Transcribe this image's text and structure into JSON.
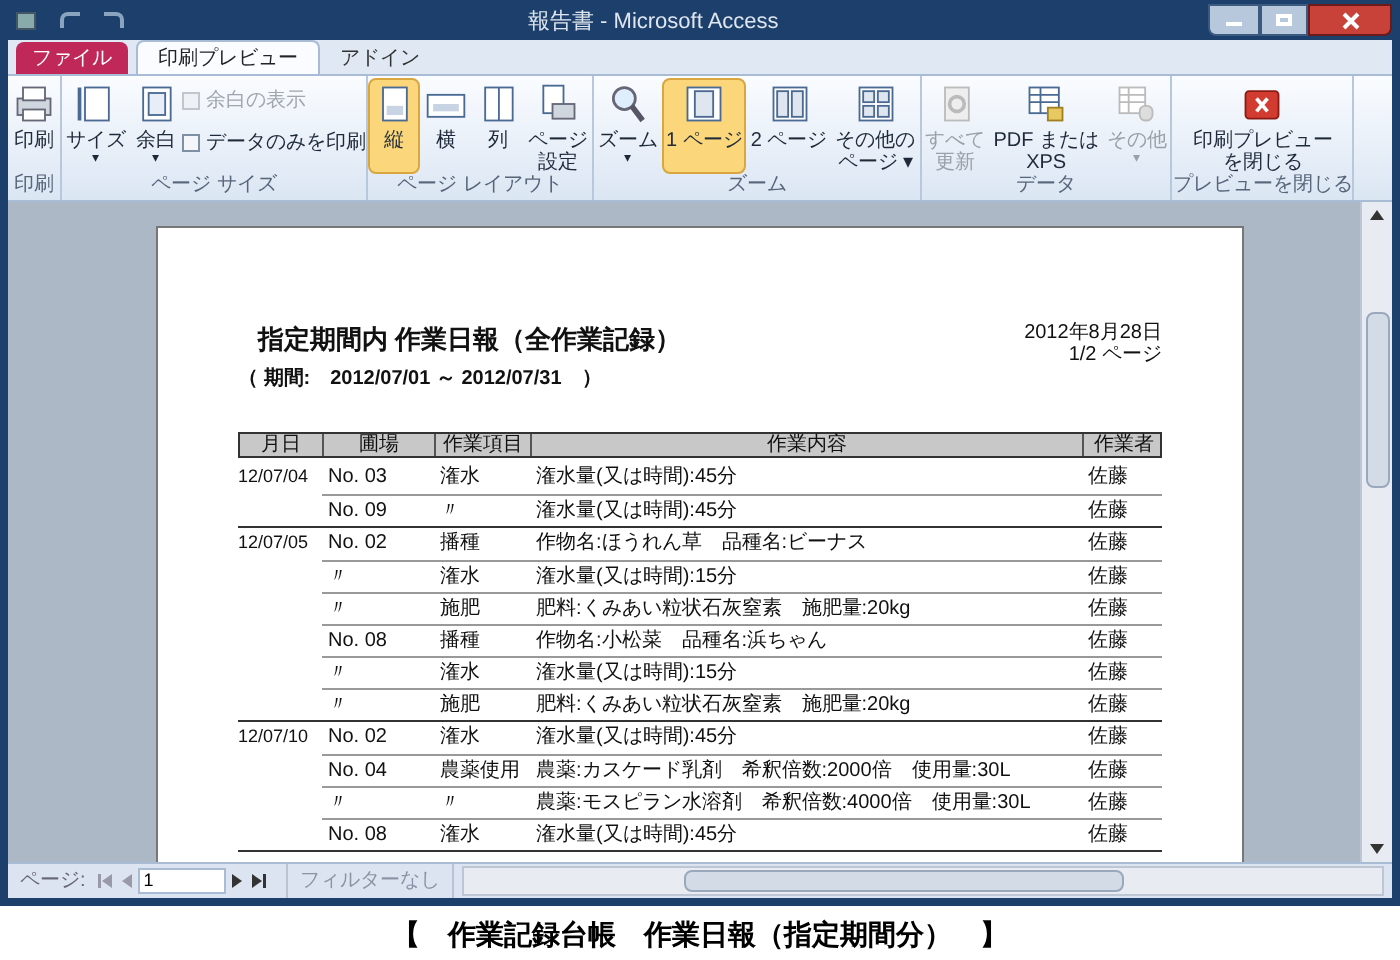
{
  "window": {
    "title": "報告書 - Microsoft Access"
  },
  "tabs": [
    {
      "label": "ファイル",
      "kind": "file",
      "selected": false
    },
    {
      "label": "印刷プレビュー",
      "kind": "tab",
      "selected": true
    },
    {
      "label": "アドイン",
      "kind": "tab",
      "selected": false
    }
  ],
  "ribbon": [
    {
      "label": "印刷",
      "items": [
        {
          "kind": "large",
          "lines": [
            "印刷"
          ],
          "disabled": false,
          "selected": false
        }
      ]
    },
    {
      "label": "ページ サイズ",
      "items": [
        {
          "kind": "large",
          "lines": [
            "サイズ"
          ],
          "arrow": "▾",
          "disabled": false,
          "selected": false
        },
        {
          "kind": "large",
          "lines": [
            "余白"
          ],
          "arrow": "▾",
          "disabled": false,
          "selected": false
        },
        {
          "kind": "checks",
          "checks": [
            {
              "label": "余白の表示",
              "checked": false,
              "disabled": true
            },
            {
              "label": "データのみを印刷",
              "checked": false,
              "disabled": false
            }
          ]
        }
      ]
    },
    {
      "label": "ページ レイアウト",
      "items": [
        {
          "kind": "large",
          "lines": [
            "縦"
          ],
          "disabled": false,
          "selected": true
        },
        {
          "kind": "large",
          "lines": [
            "横"
          ],
          "disabled": false,
          "selected": false
        },
        {
          "kind": "large",
          "lines": [
            "列"
          ],
          "disabled": false,
          "selected": false
        },
        {
          "kind": "large",
          "lines": [
            "ページ",
            "設定"
          ],
          "disabled": false,
          "selected": false
        }
      ]
    },
    {
      "label": "ズーム",
      "items": [
        {
          "kind": "large",
          "lines": [
            "ズーム"
          ],
          "arrow": "▾",
          "disabled": false,
          "selected": false
        },
        {
          "kind": "large",
          "lines": [
            "1 ページ"
          ],
          "disabled": false,
          "selected": true
        },
        {
          "kind": "large",
          "lines": [
            "2 ページ"
          ],
          "disabled": false,
          "selected": false
        },
        {
          "kind": "large",
          "lines": [
            "その他の",
            "ページ ▾"
          ],
          "disabled": false,
          "selected": false
        }
      ]
    },
    {
      "label": "データ",
      "items": [
        {
          "kind": "large",
          "lines": [
            "すべて",
            "更新"
          ],
          "disabled": true,
          "selected": false
        },
        {
          "kind": "large",
          "lines": [
            "PDF または",
            "XPS"
          ],
          "disabled": false,
          "selected": false
        },
        {
          "kind": "large",
          "lines": [
            "その他"
          ],
          "arrow": "▾",
          "disabled": true,
          "selected": false
        }
      ]
    },
    {
      "label": "プレビューを閉じる",
      "items": [
        {
          "kind": "large",
          "lines": [
            "印刷プレビュー",
            "を閉じる"
          ],
          "disabled": false,
          "selected": false
        }
      ]
    }
  ],
  "report": {
    "title": "指定期間内 作業日報（全作業記録）",
    "period": "（ 期間:　2012/07/01 ～ 2012/07/31　）",
    "date": "2012年8月28日",
    "page": "1/2 ページ",
    "columns": [
      "月日",
      "圃場",
      "作業項目",
      "作業内容",
      "作業者"
    ],
    "groups": [
      {
        "date": "12/07/04",
        "rows": [
          [
            "No. 03",
            "潅水",
            "潅水量(又は時間):45分",
            "佐藤"
          ],
          [
            "No. 09",
            "〃",
            "潅水量(又は時間):45分",
            "佐藤"
          ]
        ]
      },
      {
        "date": "12/07/05",
        "rows": [
          [
            "No. 02",
            "播種",
            "作物名:ほうれん草　品種名:ビーナス",
            "佐藤"
          ],
          [
            "〃",
            "潅水",
            "潅水量(又は時間):15分",
            "佐藤"
          ],
          [
            "〃",
            "施肥",
            "肥料:くみあい粒状石灰窒素　施肥量:20kg",
            "佐藤"
          ],
          [
            "No. 08",
            "播種",
            "作物名:小松菜　品種名:浜ちゃん",
            "佐藤"
          ],
          [
            "〃",
            "潅水",
            "潅水量(又は時間):15分",
            "佐藤"
          ],
          [
            "〃",
            "施肥",
            "肥料:くみあい粒状石灰窒素　施肥量:20kg",
            "佐藤"
          ]
        ]
      },
      {
        "date": "12/07/10",
        "rows": [
          [
            "No. 02",
            "潅水",
            "潅水量(又は時間):45分",
            "佐藤"
          ],
          [
            "No. 04",
            "農薬使用",
            "農薬:カスケード乳剤　希釈倍数:2000倍　使用量:30L",
            "佐藤"
          ],
          [
            "〃",
            "〃",
            "農薬:モスピラン水溶剤　希釈倍数:4000倍　使用量:30L",
            "佐藤"
          ],
          [
            "No. 08",
            "潅水",
            "潅水量(又は時間):45分",
            "佐藤"
          ]
        ]
      }
    ]
  },
  "navigation": {
    "label": "ページ:",
    "page": "1",
    "filter": "フィルターなし"
  },
  "caption": "【　作業記録台帳　作業日報（指定期間分）　】"
}
